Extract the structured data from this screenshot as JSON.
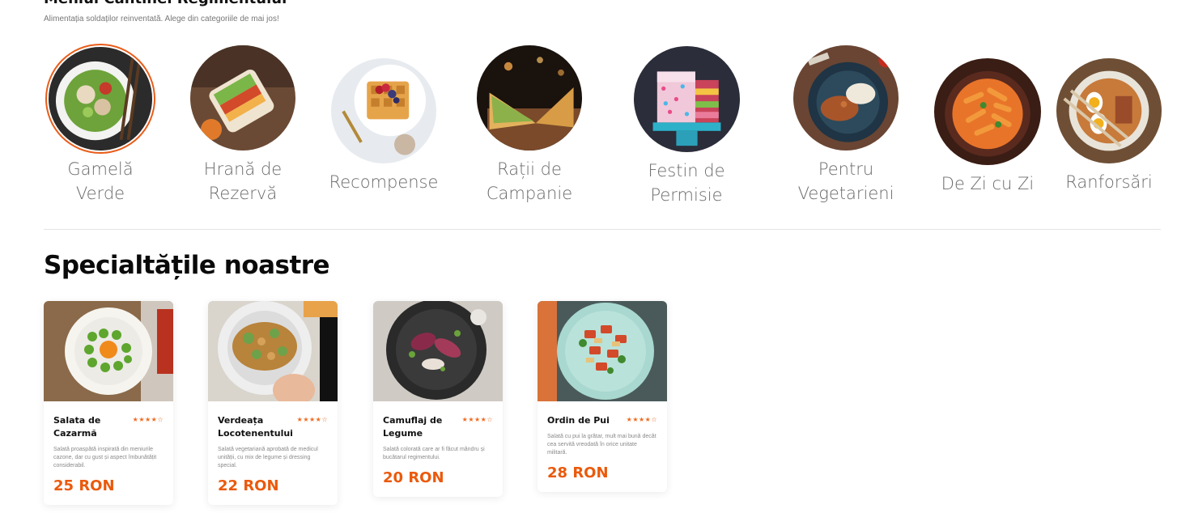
{
  "header": {
    "title_cut": "Meniul Cantinei Regimentului",
    "subtitle": "Alimentația soldaților reinventată. Alege din categoriile de mai jos!"
  },
  "categories": [
    {
      "label": "Gamelă Verde",
      "active": true
    },
    {
      "label": "Hrană de Rezervă",
      "active": false
    },
    {
      "label": "Recompense",
      "active": false
    },
    {
      "label": "Rații de Campanie",
      "active": false
    },
    {
      "label": "Festin de Permisie",
      "active": false
    },
    {
      "label": "Pentru Vegetarieni",
      "active": false
    },
    {
      "label": "De Zi cu Zi",
      "active": false
    },
    {
      "label": "Ranforsări",
      "active": false
    }
  ],
  "specialties": {
    "title": "Specialtățile noastre",
    "items": [
      {
        "name": "Salata de Cazarmă",
        "rating": "★★★★☆",
        "description": "Salată proaspătă inspirată din meniurile cazone, dar cu gust și aspect îmbunătățit considerabil.",
        "price": "25 RON"
      },
      {
        "name": "Verdeața Locotenentului",
        "rating": "★★★★☆",
        "description": "Salată vegetariană aprobată de medicul unității, cu mix de legume și dressing special.",
        "price": "22 RON"
      },
      {
        "name": "Camuflaj de Legume",
        "rating": "★★★★☆",
        "description": "Salată colorată care ar fi făcut mândru și bucătarul regimentului.",
        "price": "20 RON"
      },
      {
        "name": "Ordin de Pui",
        "rating": "★★★★☆",
        "description": "Salată cu pui la grătar, mult mai bună decât cea servită vreodată în orice unitate militară.",
        "price": "28 RON"
      }
    ]
  },
  "colors": {
    "accent": "#ea5a0c",
    "star": "#f06a1f",
    "muted_text": "#6b6b6b"
  }
}
